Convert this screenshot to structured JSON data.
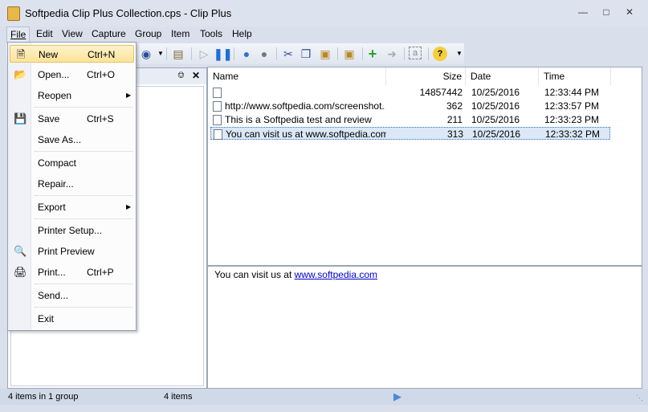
{
  "window": {
    "title": "Softpedia Clip Plus Collection.cps - Clip Plus"
  },
  "menubar": [
    "File",
    "Edit",
    "View",
    "Capture",
    "Group",
    "Item",
    "Tools",
    "Help"
  ],
  "file_menu": [
    {
      "label": "New",
      "shortcut": "Ctrl+N",
      "icon": "new-doc-icon",
      "highlighted": true
    },
    {
      "label": "Open...",
      "shortcut": "Ctrl+O",
      "icon": "open-folder-icon"
    },
    {
      "label": "Reopen",
      "submenu": true
    },
    {
      "label": "Save",
      "shortcut": "Ctrl+S",
      "icon": "save-icon"
    },
    {
      "label": "Save As..."
    },
    {
      "label": "Compact"
    },
    {
      "label": "Repair..."
    },
    {
      "label": "Export",
      "submenu": true
    },
    {
      "label": "Printer Setup..."
    },
    {
      "label": "Print Preview",
      "icon": "print-preview-icon"
    },
    {
      "label": "Print...",
      "shortcut": "Ctrl+P",
      "icon": "print-icon"
    },
    {
      "label": "Send..."
    },
    {
      "label": "Exit"
    }
  ],
  "list": {
    "columns": [
      "Name",
      "Size",
      "Date",
      "Time"
    ],
    "rows": [
      {
        "name": "",
        "size": "14857442",
        "date": "10/25/2016",
        "time": "12:33:44 PM"
      },
      {
        "name": "http://www.softpedia.com/screenshot...",
        "size": "362",
        "date": "10/25/2016",
        "time": "12:33:57 PM"
      },
      {
        "name": "This is a Softpedia test and review",
        "size": "211",
        "date": "10/25/2016",
        "time": "12:33:23 PM"
      },
      {
        "name": "You can visit us at www.softpedia.com",
        "size": "313",
        "date": "10/25/2016",
        "time": "12:33:32 PM",
        "selected": true
      }
    ]
  },
  "preview": {
    "text": "You can visit us at ",
    "link": "www.softpedia.com"
  },
  "status": {
    "left": "4 items in 1 group",
    "middle": "4 items"
  }
}
